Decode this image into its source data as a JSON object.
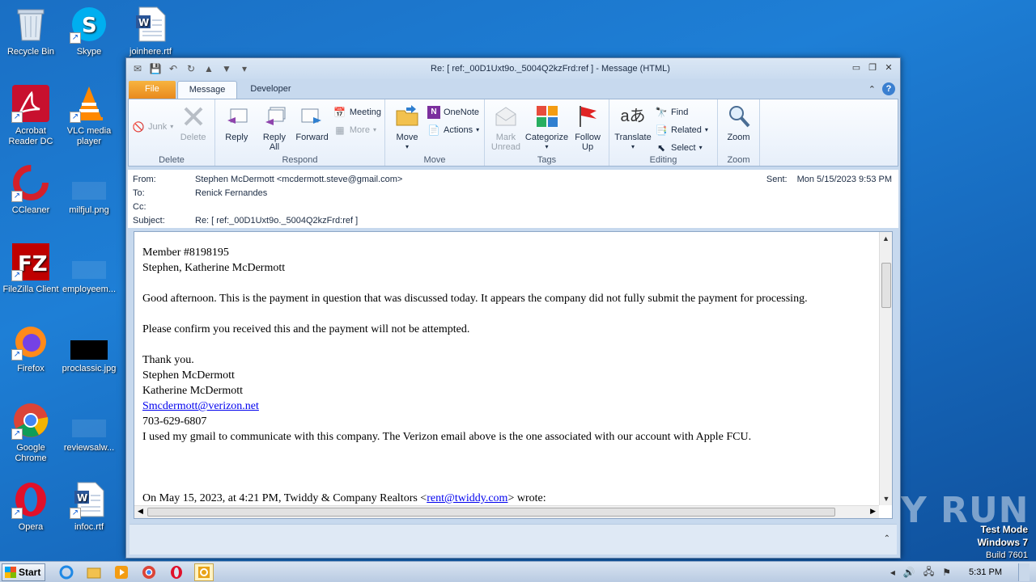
{
  "desktop": {
    "icons": [
      {
        "label": "Recycle Bin"
      },
      {
        "label": "Skype"
      },
      {
        "label": "joinhere.rtf"
      },
      {
        "label": "Acrobat Reader DC"
      },
      {
        "label": "VLC media player"
      },
      {
        "label": "CCleaner"
      },
      {
        "label": "milfjul.png"
      },
      {
        "label": "FileZilla Client"
      },
      {
        "label": "employeem..."
      },
      {
        "label": "Firefox"
      },
      {
        "label": "proclassic.jpg"
      },
      {
        "label": "Google Chrome"
      },
      {
        "label": "reviewsalw..."
      },
      {
        "label": "Opera"
      },
      {
        "label": "infoc.rtf"
      }
    ],
    "watermark": {
      "line1": "Test Mode",
      "line2": "Windows 7",
      "line3": "Build 7601"
    },
    "brand": "ANY RUN"
  },
  "window": {
    "title": "Re: [ ref:_00D1Uxt9o._5004Q2kzFrd:ref ] - Message (HTML)",
    "tabs": [
      "File",
      "Message",
      "Developer"
    ],
    "ribbon": {
      "delete_group": {
        "name": "Delete",
        "junk": "Junk",
        "delete": "Delete"
      },
      "respond_group": {
        "name": "Respond",
        "reply": "Reply",
        "reply_all_1": "Reply",
        "reply_all_2": "All",
        "forward": "Forward",
        "meeting": "Meeting",
        "more": "More"
      },
      "move_group": {
        "name": "Move",
        "move": "Move",
        "onenote": "OneNote",
        "actions": "Actions"
      },
      "tags_group": {
        "name": "Tags",
        "mark_unread_1": "Mark",
        "mark_unread_2": "Unread",
        "categorize": "Categorize",
        "follow_up_1": "Follow",
        "follow_up_2": "Up"
      },
      "editing_group": {
        "name": "Editing",
        "translate": "Translate",
        "find": "Find",
        "related": "Related",
        "select": "Select"
      },
      "zoom_group": {
        "name": "Zoom",
        "zoom": "Zoom"
      }
    },
    "header": {
      "from_label": "From:",
      "from_value": "Stephen McDermott <mcdermott.steve@gmail.com>",
      "to_label": "To:",
      "to_value": "Renick Fernandes",
      "cc_label": "Cc:",
      "cc_value": "",
      "subject_label": "Subject:",
      "subject_value": "Re: [ ref:_00D1Uxt9o._5004Q2kzFrd:ref ]",
      "sent_label": "Sent:",
      "sent_value": "Mon 5/15/2023 9:53 PM"
    },
    "body": {
      "line1": "Member #8198195",
      "line2": "Stephen, Katherine McDermott",
      "line3": "Good afternoon. This is the payment in question that was discussed today. It appears the company did not fully submit the payment for processing.",
      "line4": "Please confirm you received this and the payment will not be attempted.",
      "line5": "Thank you.",
      "line6": "Stephen McDermott",
      "line7": "Katherine McDermott",
      "email_link": "Smcdermott@verizon.net",
      "phone": "703-629-6807",
      "line8": "I used my gmail to communicate with this company. The Verizon email above is the one associated with our account with Apple FCU.",
      "quote_prefix": "On May 15, 2023, at 4:21 PM, Twiddy & Company Realtors <",
      "quote_link": "rent@twiddy.com",
      "quote_suffix": "> wrote:"
    }
  },
  "taskbar": {
    "start": "Start",
    "clock": "5:31 PM"
  }
}
